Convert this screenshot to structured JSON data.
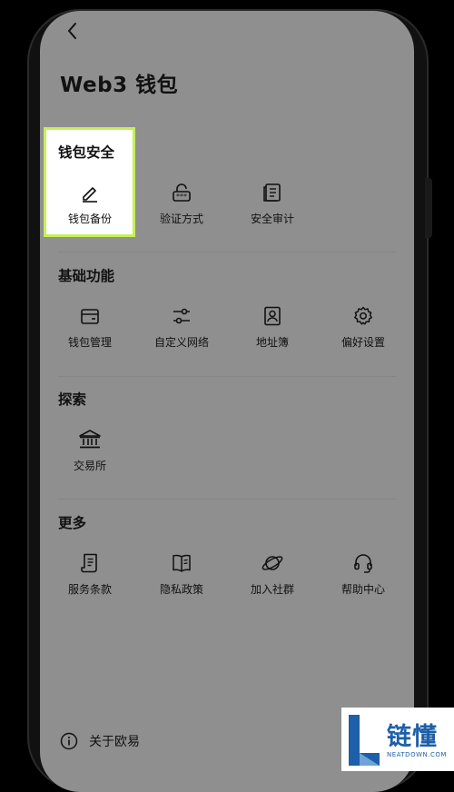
{
  "page": {
    "title": "Web3 钱包"
  },
  "sections": [
    {
      "title": "钱包安全",
      "items": [
        {
          "label": "钱包备份",
          "icon": "pencil-icon"
        },
        {
          "label": "验证方式",
          "icon": "lock-password-icon"
        },
        {
          "label": "安全审计",
          "icon": "document-icon"
        }
      ]
    },
    {
      "title": "基础功能",
      "items": [
        {
          "label": "钱包管理",
          "icon": "wallet-icon"
        },
        {
          "label": "自定义网络",
          "icon": "sliders-icon"
        },
        {
          "label": "地址簿",
          "icon": "contact-book-icon"
        },
        {
          "label": "偏好设置",
          "icon": "gear-icon"
        }
      ]
    },
    {
      "title": "探索",
      "items": [
        {
          "label": "交易所",
          "icon": "bank-icon"
        }
      ]
    },
    {
      "title": "更多",
      "items": [
        {
          "label": "服务条款",
          "icon": "terms-icon"
        },
        {
          "label": "隐私政策",
          "icon": "book-icon"
        },
        {
          "label": "加入社群",
          "icon": "planet-icon"
        },
        {
          "label": "帮助中心",
          "icon": "headset-icon"
        }
      ]
    }
  ],
  "footer": {
    "about_label": "关于欧易",
    "icon": "info-icon"
  },
  "watermark": {
    "text": "链懂",
    "subtext": "NEATDOWN.COM"
  },
  "colors": {
    "screen_bg": "#8f8f8f",
    "highlight_border": "#c6ef58",
    "watermark_blue": "#1d5fa8"
  }
}
